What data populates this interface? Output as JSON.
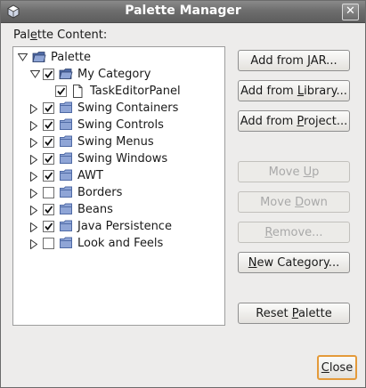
{
  "window": {
    "title": "Palette Manager",
    "close_symbol": "✕"
  },
  "palette_content_label": {
    "pre": "Pal",
    "mnemonic": "e",
    "post": "tte Content:"
  },
  "tree": [
    {
      "label": "Palette",
      "level": 0,
      "expanded": true,
      "checkbox": null,
      "icon": "palette-folder-icon"
    },
    {
      "label": "My Category",
      "level": 1,
      "expanded": true,
      "checkbox": true,
      "icon": "category-folder-icon"
    },
    {
      "label": "TaskEditorPanel",
      "level": 2,
      "expanded": null,
      "checkbox": true,
      "icon": "document-icon"
    },
    {
      "label": "Swing Containers",
      "level": 1,
      "expanded": false,
      "checkbox": true,
      "icon": "folder-icon"
    },
    {
      "label": "Swing Controls",
      "level": 1,
      "expanded": false,
      "checkbox": true,
      "icon": "folder-icon"
    },
    {
      "label": "Swing Menus",
      "level": 1,
      "expanded": false,
      "checkbox": true,
      "icon": "folder-icon"
    },
    {
      "label": "Swing Windows",
      "level": 1,
      "expanded": false,
      "checkbox": true,
      "icon": "folder-icon"
    },
    {
      "label": "AWT",
      "level": 1,
      "expanded": false,
      "checkbox": true,
      "icon": "folder-icon"
    },
    {
      "label": "Borders",
      "level": 1,
      "expanded": false,
      "checkbox": false,
      "icon": "folder-icon"
    },
    {
      "label": "Beans",
      "level": 1,
      "expanded": false,
      "checkbox": true,
      "icon": "folder-icon"
    },
    {
      "label": "Java Persistence",
      "level": 1,
      "expanded": false,
      "checkbox": true,
      "icon": "folder-icon"
    },
    {
      "label": "Look and Feels",
      "level": 1,
      "expanded": false,
      "checkbox": false,
      "icon": "folder-icon"
    }
  ],
  "buttons": {
    "add_from_jar": {
      "pre": "Add from ",
      "mnemonic": "J",
      "post": "AR...",
      "enabled": true
    },
    "add_from_library": {
      "pre": "Add from ",
      "mnemonic": "L",
      "post": "ibrary...",
      "enabled": true
    },
    "add_from_project": {
      "pre": "Add from ",
      "mnemonic": "P",
      "post": "roject...",
      "enabled": true
    },
    "move_up": {
      "pre": "Move ",
      "mnemonic": "U",
      "post": "p",
      "enabled": false
    },
    "move_down": {
      "pre": "Move ",
      "mnemonic": "D",
      "post": "own",
      "enabled": false
    },
    "remove": {
      "pre": "",
      "mnemonic": "R",
      "post": "emove...",
      "enabled": false
    },
    "new_category": {
      "pre": "",
      "mnemonic": "N",
      "post": "ew Category...",
      "enabled": true
    },
    "reset_palette": {
      "pre": "Reset ",
      "mnemonic": "P",
      "post": "alette",
      "enabled": true
    },
    "close": {
      "pre": "",
      "mnemonic": "C",
      "post": "lose",
      "enabled": true
    }
  },
  "colors": {
    "folder_blue": "#8fa5d6",
    "folder_dark": "#4f6aa5",
    "title_bar": "#6e6e6e",
    "close_focus": "#e49a3a"
  }
}
